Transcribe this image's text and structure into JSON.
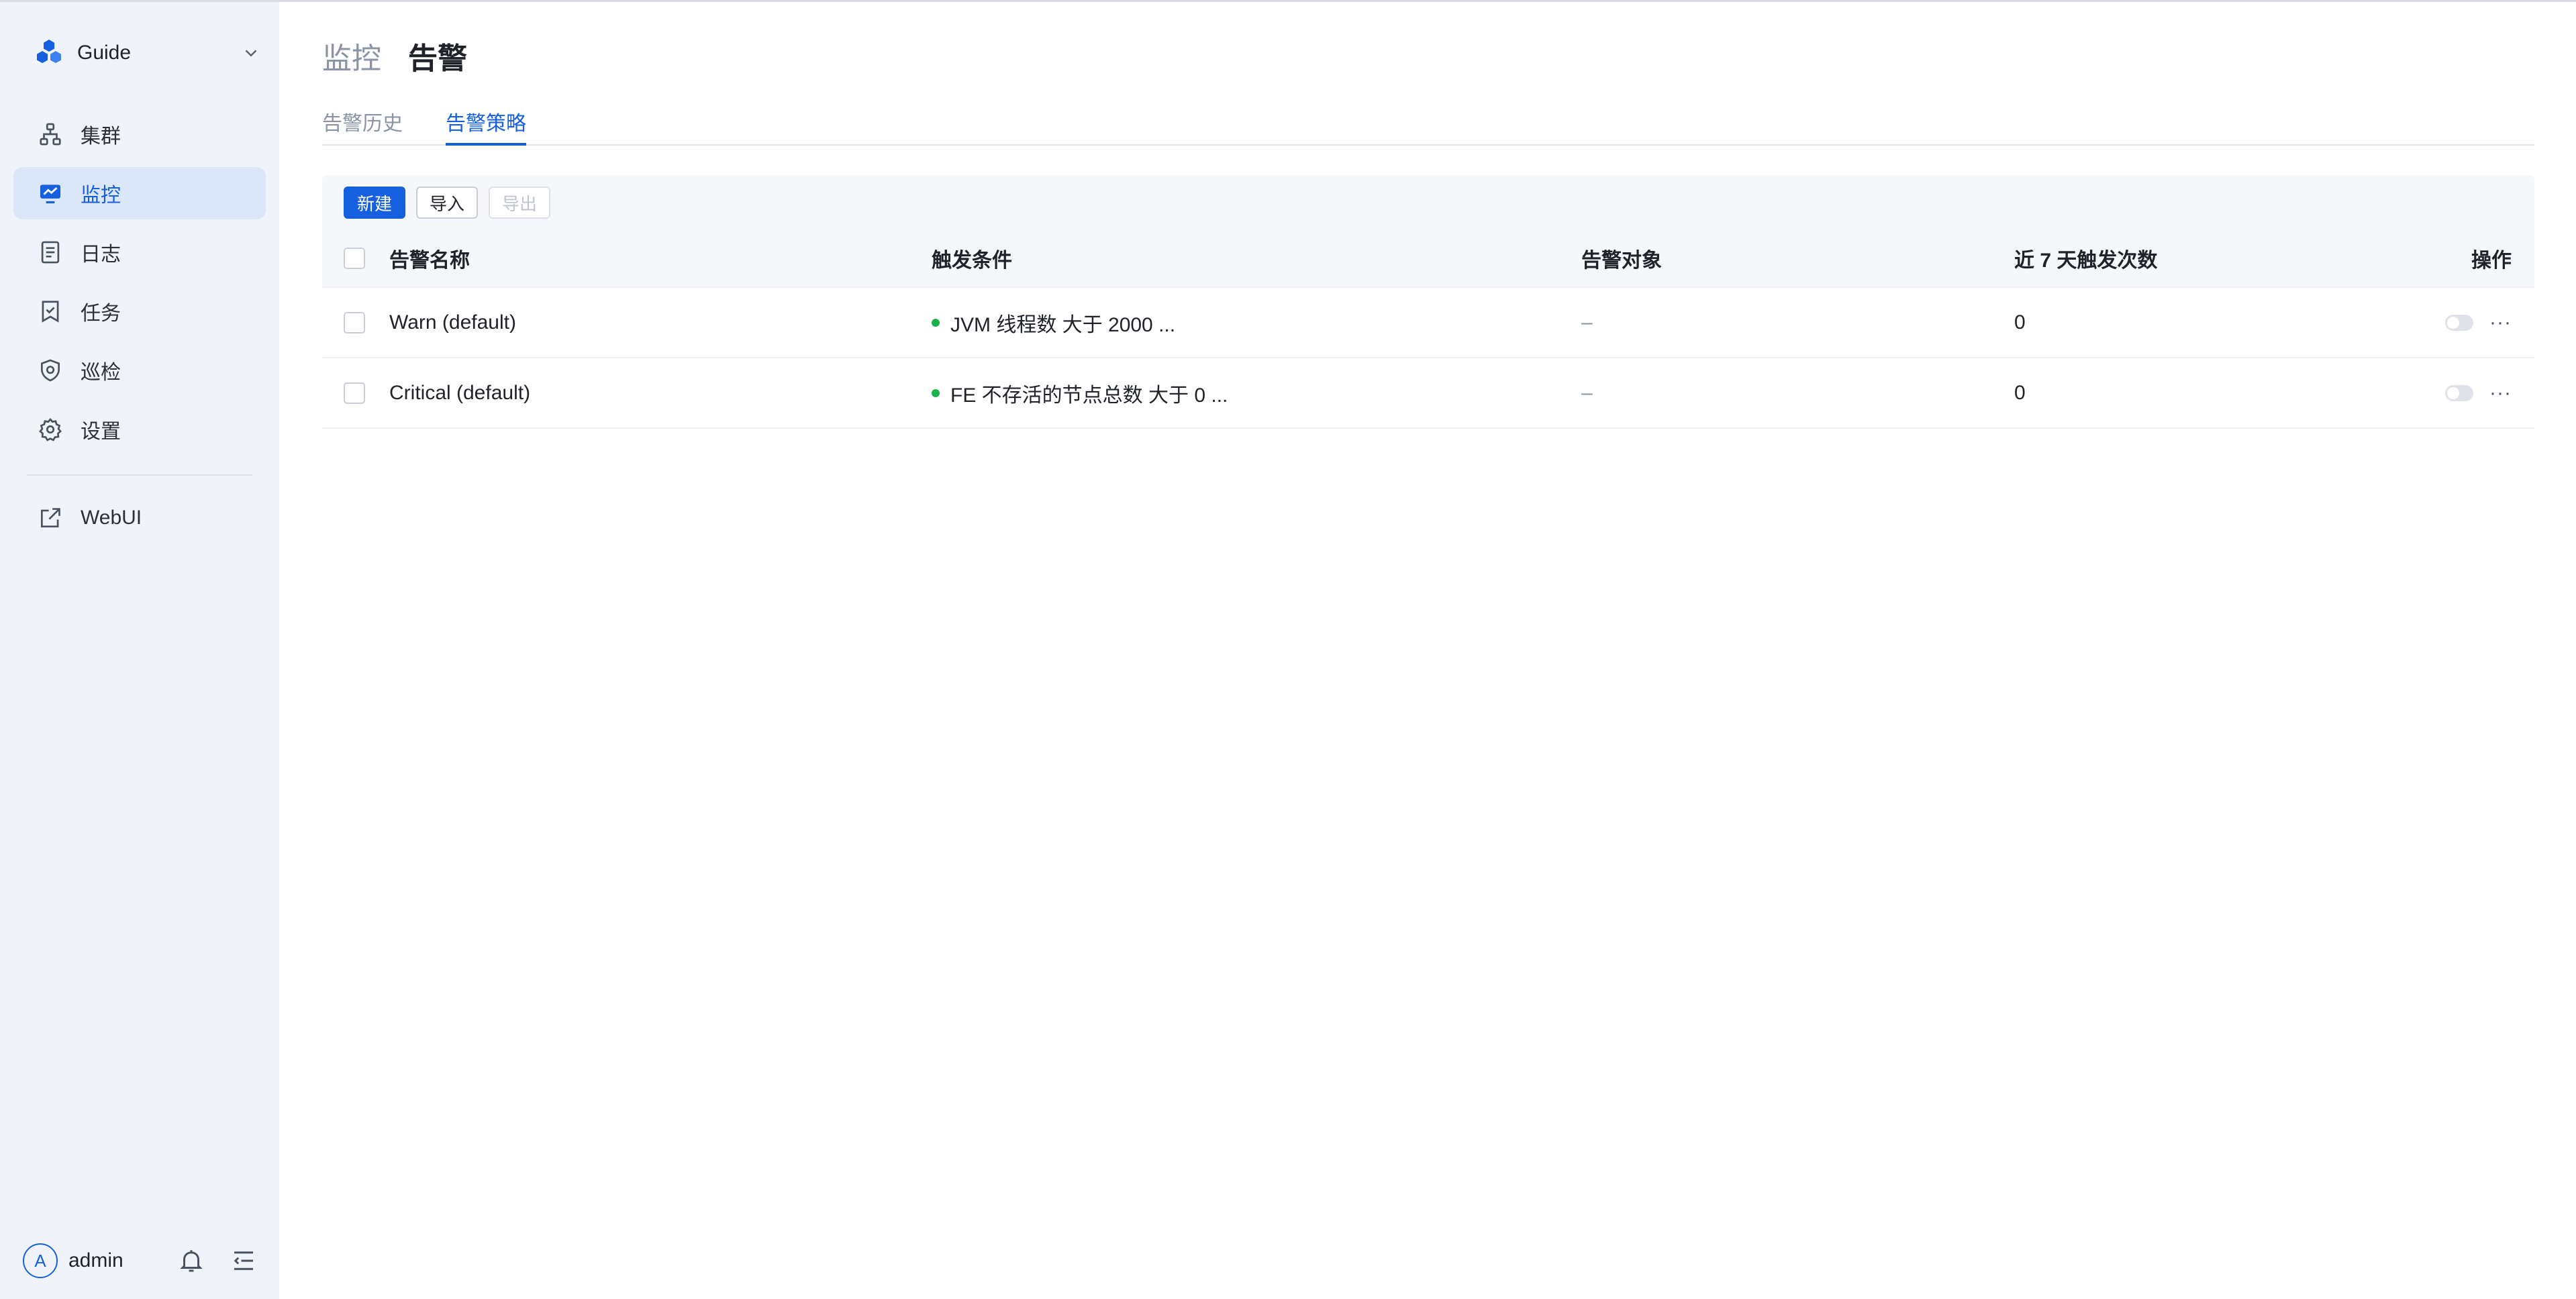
{
  "sidebar": {
    "brand": "Guide",
    "items": [
      {
        "label": "集群",
        "icon": "cluster-icon",
        "active": false
      },
      {
        "label": "监控",
        "icon": "monitor-icon",
        "active": true
      },
      {
        "label": "日志",
        "icon": "log-icon",
        "active": false
      },
      {
        "label": "任务",
        "icon": "task-icon",
        "active": false
      },
      {
        "label": "巡检",
        "icon": "inspection-icon",
        "active": false
      },
      {
        "label": "设置",
        "icon": "settings-icon",
        "active": false
      }
    ],
    "external": {
      "label": "WebUI",
      "icon": "external-link-icon"
    },
    "user": {
      "initial": "A",
      "name": "admin"
    }
  },
  "header": {
    "breadcrumb": "监控",
    "title": "告警"
  },
  "tabs": [
    {
      "label": "告警历史",
      "active": false
    },
    {
      "label": "告警策略",
      "active": true
    }
  ],
  "toolbar": {
    "new_label": "新建",
    "import_label": "导入",
    "export_label": "导出"
  },
  "table": {
    "headers": {
      "name": "告警名称",
      "condition": "触发条件",
      "target": "告警对象",
      "count": "近 7 天触发次数",
      "actions": "操作"
    },
    "rows": [
      {
        "name": "Warn (default)",
        "condition": "JVM 线程数 大于 2000 ...",
        "target": "–",
        "count": "0",
        "more": "···"
      },
      {
        "name": "Critical (default)",
        "condition": "FE 不存活的节点总数 大于 0 ...",
        "target": "–",
        "count": "0",
        "more": "···"
      }
    ]
  },
  "colors": {
    "accent": "#1660e0",
    "sidebar_bg": "#f0f4fa",
    "status_ok": "#19b34a"
  }
}
